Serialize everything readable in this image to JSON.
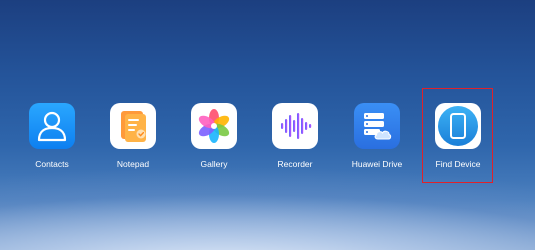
{
  "apps": [
    {
      "id": "contacts",
      "label": "Contacts",
      "icon": "contacts-icon"
    },
    {
      "id": "notepad",
      "label": "Notepad",
      "icon": "notepad-icon"
    },
    {
      "id": "gallery",
      "label": "Gallery",
      "icon": "gallery-icon"
    },
    {
      "id": "recorder",
      "label": "Recorder",
      "icon": "recorder-icon"
    },
    {
      "id": "huawei-drive",
      "label": "Huawei Drive",
      "icon": "cloud-drive-icon"
    },
    {
      "id": "find-device",
      "label": "Find Device",
      "icon": "find-device-icon",
      "highlighted": true
    }
  ],
  "colors": {
    "highlight": "#e0222a",
    "label": "#ffffff",
    "accent_blue": "#0d7ff0"
  }
}
